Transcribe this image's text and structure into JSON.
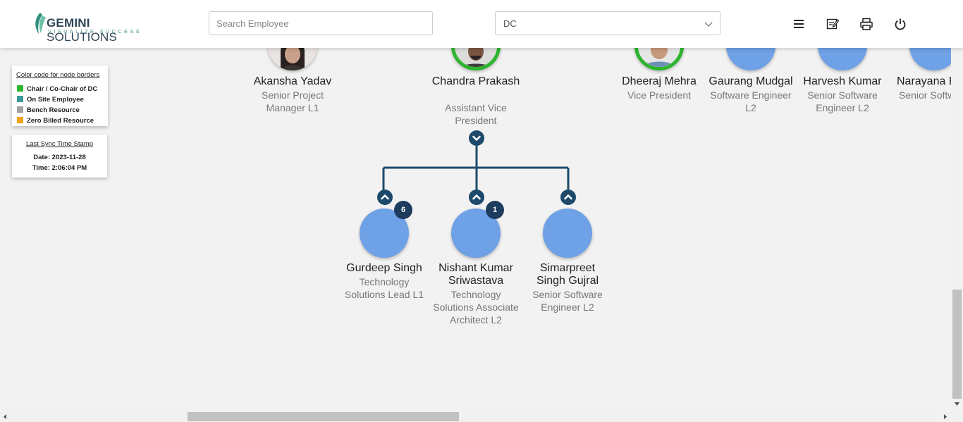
{
  "header": {
    "logo_name_bold": "GEMINI",
    "logo_name": " SOLUTIONS",
    "logo_tagline": "VISUALIZE SUCCESS",
    "search_placeholder": "Search Employee",
    "dropdown_value": "DC",
    "icons": [
      "menu-icon",
      "edit-icon",
      "print-icon",
      "power-icon"
    ]
  },
  "legend": {
    "title": "Color code for node borders",
    "items": [
      {
        "label": "Chair / Co-Chair of DC",
        "color": "#2db52d"
      },
      {
        "label": "On Site Employee",
        "color": "#3b9a9a"
      },
      {
        "label": "Bench Resource",
        "color": "#a0a0a0"
      },
      {
        "label": "Zero Billed Resource",
        "color": "#f3a31a"
      }
    ]
  },
  "sync": {
    "title": "Last Sync Time Stamp",
    "date": "Date: 2023-11-28",
    "time": "Time: 2:06:04 PM"
  },
  "top_row": [
    {
      "name": "Akansha Yadav",
      "title": "Senior Project Manager L1",
      "photo": true
    },
    {
      "name": "Chandra Prakash",
      "title": "Assistant Vice President",
      "photo": true,
      "border": "#2db52d"
    },
    {
      "name": "Dheeraj Mehra",
      "title": "Vice President",
      "photo": true,
      "border": "#2db52d"
    },
    {
      "name": "Gaurang Mudgal",
      "title": "Software Engineer L2"
    },
    {
      "name": "Harvesh Kumar",
      "title": "Senior Software Engineer L2"
    },
    {
      "name": "Narayana B",
      "title": "Senior Softw Engineer L"
    }
  ],
  "children": [
    {
      "name": "Gurdeep Singh",
      "title": "Technology Solutions Lead L1",
      "badge": "6"
    },
    {
      "name": "Nishant Kumar Sriwastava",
      "title": "Technology Solutions Associate Architect L2",
      "badge": "1"
    },
    {
      "name": "Simarpreet Singh Gujral",
      "title": "Senior Software Engineer L2",
      "badge": ""
    }
  ],
  "colors": {
    "node_fill": "#6fa1e6",
    "connector": "#1d4a6a",
    "badge": "#1d3c5e"
  }
}
